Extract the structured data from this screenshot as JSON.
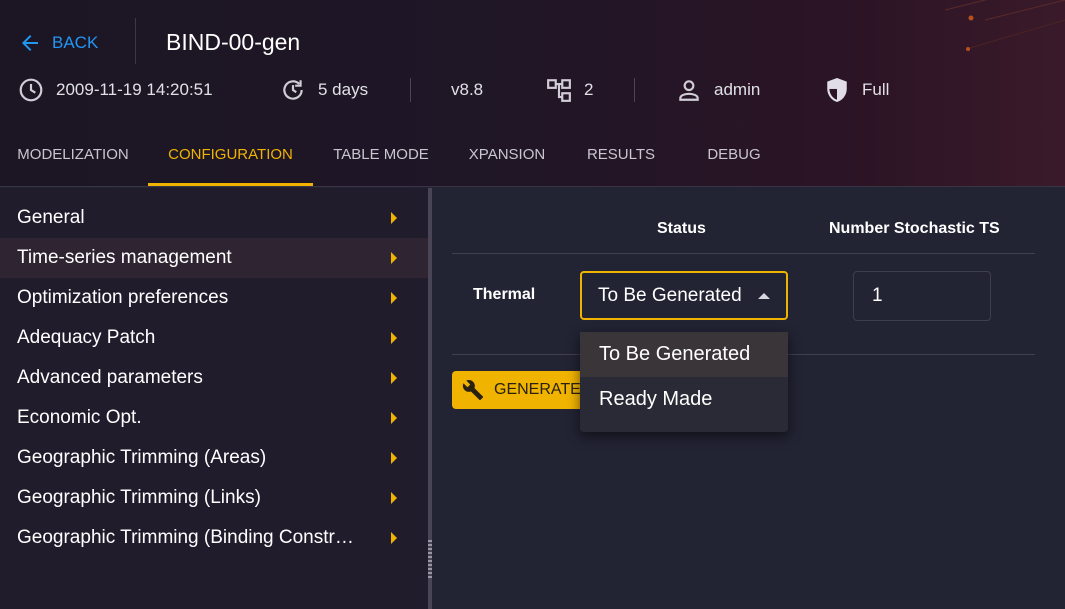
{
  "header": {
    "back_label": "BACK",
    "study_title": "BIND-00-gen",
    "meta": {
      "date": "2009-11-19 14:20:51",
      "age": "5 days",
      "version": "v8.8",
      "tree_count": "2",
      "owner": "admin",
      "permission": "Full"
    },
    "tabs": [
      {
        "label": "MODELIZATION"
      },
      {
        "label": "CONFIGURATION"
      },
      {
        "label": "TABLE MODE"
      },
      {
        "label": "XPANSION"
      },
      {
        "label": "RESULTS"
      },
      {
        "label": "DEBUG"
      }
    ],
    "active_tab": "CONFIGURATION"
  },
  "sidebar": {
    "items": [
      {
        "label": "General"
      },
      {
        "label": "Time-series management"
      },
      {
        "label": "Optimization preferences"
      },
      {
        "label": "Adequacy Patch"
      },
      {
        "label": "Advanced parameters"
      },
      {
        "label": "Economic Opt."
      },
      {
        "label": "Geographic Trimming (Areas)"
      },
      {
        "label": "Geographic Trimming (Links)"
      },
      {
        "label": "Geographic Trimming (Binding Constr…"
      }
    ],
    "active_item": "Time-series management"
  },
  "table": {
    "columns": [
      "Status",
      "Number Stochastic TS"
    ],
    "rows": [
      {
        "label": "Thermal",
        "status": "To Be Generated",
        "number_stochastic_ts": "1"
      }
    ]
  },
  "generate_button": {
    "label": "GENERATE"
  },
  "status_dropdown": {
    "options": [
      "To Be Generated",
      "Ready Made"
    ],
    "selected": "To Be Generated"
  },
  "colors": {
    "accent": "#f0b300",
    "link": "#2196f3",
    "background": "#222333",
    "sidebar": "#211c2c"
  },
  "icons": {
    "back": "arrow-left-icon",
    "date": "clock-icon",
    "age": "history-icon",
    "tree": "tree-icon",
    "owner": "user-icon",
    "permission": "shield-icon",
    "generate": "wrench-icon",
    "sidebar_chevron": "chevron-right-icon"
  }
}
